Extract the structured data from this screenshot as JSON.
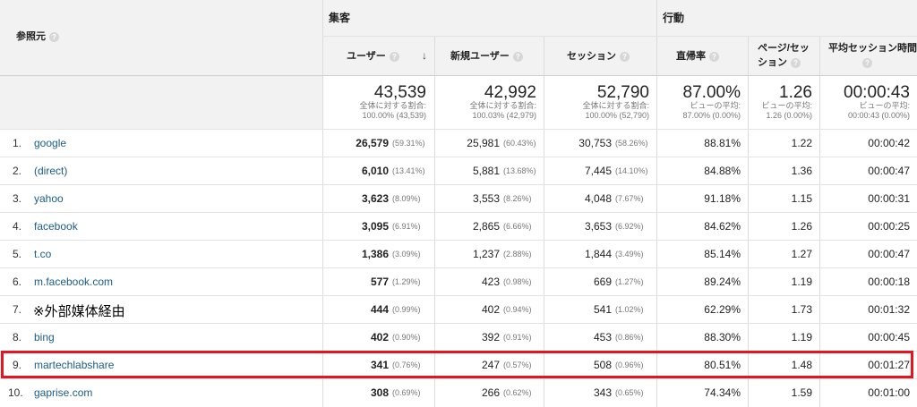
{
  "header": {
    "source_label": "参照元",
    "group_acquisition": "集客",
    "group_behavior": "行動",
    "col_users": "ユーザー",
    "col_new_users": "新規ユーザー",
    "col_sessions": "セッション",
    "col_bounce": "直帰率",
    "col_pages_a": "ページ/セッ",
    "col_pages_b": "ション",
    "col_avg_duration": "平均セッション時間",
    "sort_arrow": "↓"
  },
  "totals": {
    "users": "43,539",
    "users_sub1": "全体に対する割合:",
    "users_sub2": "100.00% (43,539)",
    "new_users": "42,992",
    "new_users_sub1": "全体に対する割合:",
    "new_users_sub2": "100.03% (42,979)",
    "sessions": "52,790",
    "sessions_sub1": "全体に対する割合:",
    "sessions_sub2": "100.00% (52,790)",
    "bounce": "87.00%",
    "bounce_sub1": "ビューの平均:",
    "bounce_sub2": "87.00% (0.00%)",
    "pages": "1.26",
    "pages_sub1": "ビューの平均:",
    "pages_sub2": "1.26 (0.00%)",
    "duration": "00:00:43",
    "duration_sub1": "ビューの平均:",
    "duration_sub2": "00:00:43 (0.00%)"
  },
  "rows": [
    {
      "num": "1.",
      "source": "google",
      "users": "26,579",
      "users_pct": "(59.31%)",
      "new_users": "25,981",
      "new_users_pct": "(60.43%)",
      "sessions": "30,753",
      "sessions_pct": "(58.26%)",
      "bounce": "88.81%",
      "pages": "1.22",
      "duration": "00:00:42"
    },
    {
      "num": "2.",
      "source": "(direct)",
      "users": "6,010",
      "users_pct": "(13.41%)",
      "new_users": "5,881",
      "new_users_pct": "(13.68%)",
      "sessions": "7,445",
      "sessions_pct": "(14.10%)",
      "bounce": "84.88%",
      "pages": "1.36",
      "duration": "00:00:47"
    },
    {
      "num": "3.",
      "source": "yahoo",
      "users": "3,623",
      "users_pct": "(8.09%)",
      "new_users": "3,553",
      "new_users_pct": "(8.26%)",
      "sessions": "4,048",
      "sessions_pct": "(7.67%)",
      "bounce": "91.18%",
      "pages": "1.15",
      "duration": "00:00:31"
    },
    {
      "num": "4.",
      "source": "facebook",
      "users": "3,095",
      "users_pct": "(6.91%)",
      "new_users": "2,865",
      "new_users_pct": "(6.66%)",
      "sessions": "3,653",
      "sessions_pct": "(6.92%)",
      "bounce": "84.62%",
      "pages": "1.26",
      "duration": "00:00:25"
    },
    {
      "num": "5.",
      "source": "t.co",
      "users": "1,386",
      "users_pct": "(3.09%)",
      "new_users": "1,237",
      "new_users_pct": "(2.88%)",
      "sessions": "1,844",
      "sessions_pct": "(3.49%)",
      "bounce": "85.14%",
      "pages": "1.27",
      "duration": "00:00:47"
    },
    {
      "num": "6.",
      "source": "m.facebook.com",
      "users": "577",
      "users_pct": "(1.29%)",
      "new_users": "423",
      "new_users_pct": "(0.98%)",
      "sessions": "669",
      "sessions_pct": "(1.27%)",
      "bounce": "89.24%",
      "pages": "1.19",
      "duration": "00:00:18"
    },
    {
      "num": "7.",
      "source": "※外部媒体経由",
      "users": "444",
      "users_pct": "(0.99%)",
      "new_users": "402",
      "new_users_pct": "(0.94%)",
      "sessions": "541",
      "sessions_pct": "(1.02%)",
      "bounce": "62.29%",
      "pages": "1.73",
      "duration": "00:01:32"
    },
    {
      "num": "8.",
      "source": "bing",
      "users": "402",
      "users_pct": "(0.90%)",
      "new_users": "392",
      "new_users_pct": "(0.91%)",
      "sessions": "453",
      "sessions_pct": "(0.86%)",
      "bounce": "88.30%",
      "pages": "1.19",
      "duration": "00:00:45"
    },
    {
      "num": "9.",
      "source": "martechlabshare",
      "users": "341",
      "users_pct": "(0.76%)",
      "new_users": "247",
      "new_users_pct": "(0.57%)",
      "sessions": "508",
      "sessions_pct": "(0.96%)",
      "bounce": "80.51%",
      "pages": "1.48",
      "duration": "00:01:27"
    },
    {
      "num": "10.",
      "source": "gaprise.com",
      "users": "308",
      "users_pct": "(0.69%)",
      "new_users": "266",
      "new_users_pct": "(0.62%)",
      "sessions": "343",
      "sessions_pct": "(0.65%)",
      "bounce": "74.34%",
      "pages": "1.59",
      "duration": "00:01:00"
    }
  ],
  "colors": {
    "link": "#1a5c8a",
    "highlight": "#e5141e",
    "header_bg": "#f2f2f2"
  }
}
